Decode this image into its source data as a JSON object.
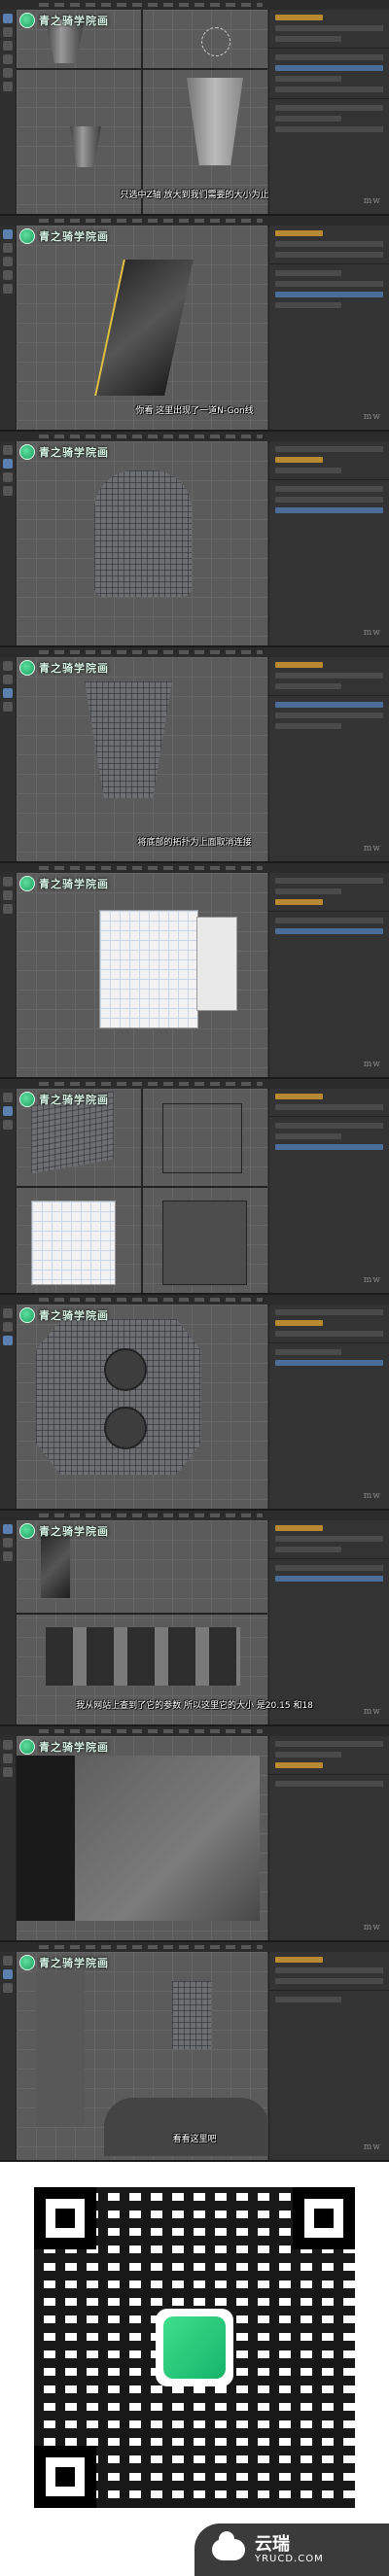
{
  "logo_text": "青之骑学院画",
  "watermark": "mw",
  "captions": [
    "只选中Z轴 放大到我们需要的大小为止",
    "你看 这里出现了一道N-Gon线",
    "",
    "将底部的拓扑为上面取消连接",
    "",
    "",
    "",
    "我从网站上查到了它的参数 所以这里它的大小 是20.15 和18",
    "",
    "看看这里吧"
  ],
  "brand": {
    "name": "云瑞",
    "url": "YRUCD.COM"
  },
  "colors": {
    "viewport": "#5b5b5b",
    "panel": "#333333",
    "accent": "#b8892e",
    "brand_green": "#16b36a"
  },
  "icons": [
    "logo-icon",
    "cloud-icon",
    "qr-code",
    "toolbar-icon"
  ]
}
